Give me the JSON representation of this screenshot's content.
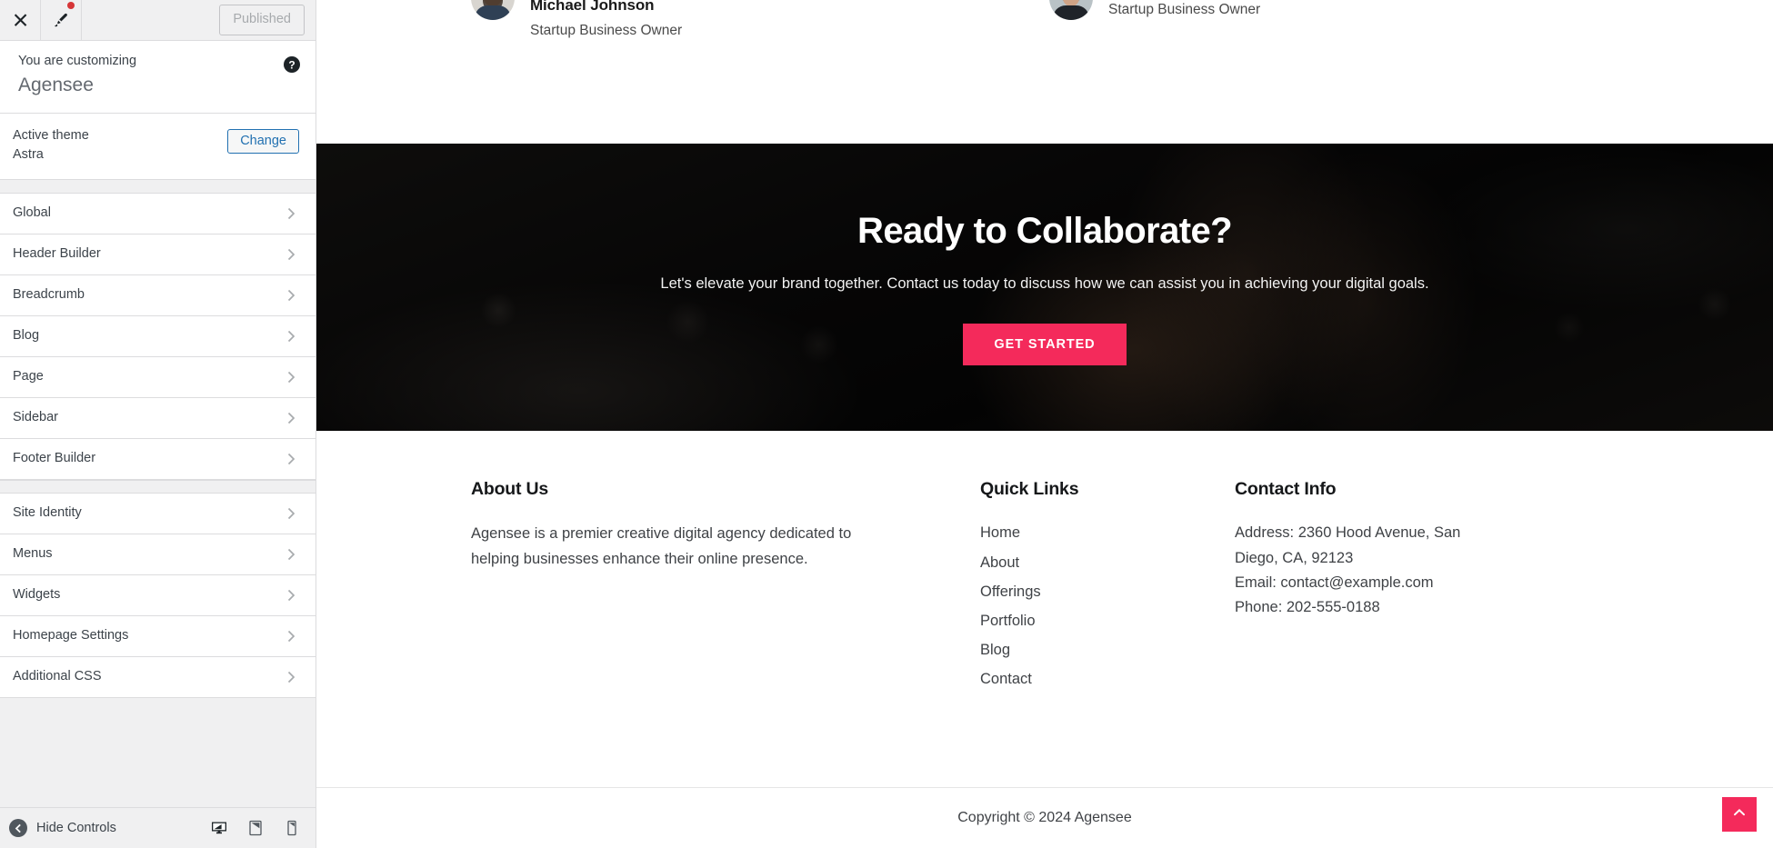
{
  "customizer": {
    "topbar": {
      "close_icon": "close-icon",
      "brush_icon": "paintbrush-icon",
      "publish_label": "Published",
      "has_notification_dot": true
    },
    "header": {
      "customizing_label": "You are customizing",
      "site_name": "Agensee",
      "help_icon": "help-icon"
    },
    "theme": {
      "active_theme_label": "Active theme",
      "theme_name": "Astra",
      "change_label": "Change"
    },
    "group_one": [
      {
        "label": "Global"
      },
      {
        "label": "Header Builder"
      },
      {
        "label": "Breadcrumb"
      },
      {
        "label": "Blog"
      },
      {
        "label": "Page"
      },
      {
        "label": "Sidebar"
      },
      {
        "label": "Footer Builder"
      }
    ],
    "group_two": [
      {
        "label": "Site Identity"
      },
      {
        "label": "Menus"
      },
      {
        "label": "Widgets"
      },
      {
        "label": "Homepage Settings"
      },
      {
        "label": "Additional CSS"
      }
    ],
    "footer": {
      "hide_controls_label": "Hide Controls",
      "collapse_icon": "collapse-arrow-icon",
      "devices": [
        {
          "name": "desktop",
          "icon": "desktop-icon",
          "active": true
        },
        {
          "name": "tablet",
          "icon": "tablet-icon",
          "active": false
        },
        {
          "name": "mobile",
          "icon": "mobile-icon",
          "active": false
        }
      ]
    }
  },
  "preview": {
    "testimonials": [
      {
        "name": "Michael Johnson",
        "role": "Startup Business Owner"
      },
      {
        "name": "",
        "role": "Startup Business Owner"
      }
    ],
    "cta": {
      "title": "Ready to Collaborate?",
      "subtitle": "Let's elevate your brand together. Contact us today to discuss how we can assist you in achieving your digital goals.",
      "button_label": "GET STARTED",
      "button_color": "#F42A5B"
    },
    "footer": {
      "about": {
        "heading": "About Us",
        "text": "Agensee is a premier creative digital agency dedicated to helping businesses enhance their online presence."
      },
      "quick_links": {
        "heading": "Quick Links",
        "items": [
          "Home",
          "About",
          "Offerings",
          "Portfolio",
          "Blog",
          "Contact"
        ]
      },
      "contact": {
        "heading": "Contact Info",
        "lines": [
          "Address: 2360 Hood Avenue, San",
          "Diego, CA, 92123",
          "Email: contact@example.com",
          "Phone: 202-555-0188"
        ]
      },
      "copyright": "Copyright © 2024 Agensee",
      "scroll_top_icon": "chevron-up-icon",
      "accent_color": "#F42A5B"
    }
  }
}
